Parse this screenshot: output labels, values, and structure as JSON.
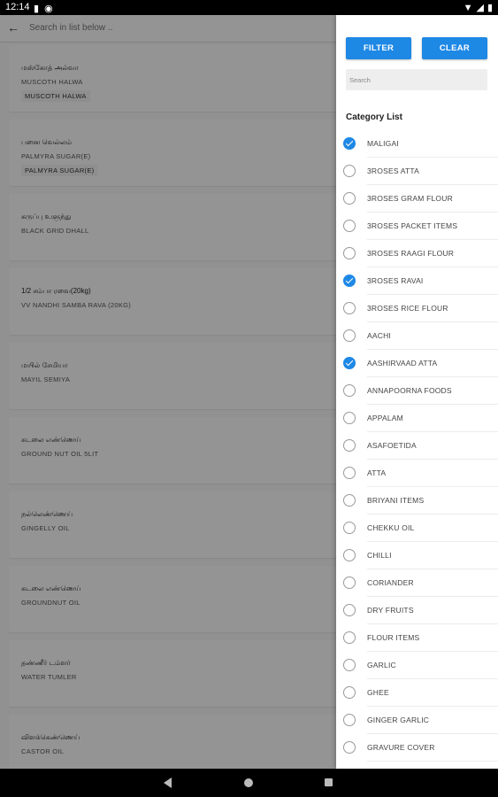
{
  "status_bar": {
    "time": "12:14"
  },
  "search_bar": {
    "placeholder": "Search in list below .."
  },
  "products": [
    {
      "tamil": "மஸ்கோத் அல்வா",
      "english": "MUSCOTH HALWA",
      "tag": "MUSCOTH HALWA"
    },
    {
      "tamil": "பனை வெல்லம்",
      "english": "PALMYRA SUGAR(E)",
      "tag": "PALMYRA SUGAR(E)"
    },
    {
      "tamil": "கருப்பு உளுந்து",
      "english": "BLACK GRID DHALL",
      "tag": ""
    },
    {
      "tamil": "1/2 சம்பா ரவை(20kg)",
      "english": "VV NANDHI SAMBA RAVA (20KG)",
      "tag": ""
    },
    {
      "tamil": "மயில் சேமியா",
      "english": "MAYIL SEMIYA",
      "tag": ""
    },
    {
      "tamil": "கடலை எண்ணெய்",
      "english": "GROUND NUT OIL 5LIT",
      "tag": ""
    },
    {
      "tamil": "நல்லெண்ணெய்",
      "english": "GINGELLY OIL",
      "tag": ""
    },
    {
      "tamil": "கடலை எண்ணெய்",
      "english": "GROUNDNUT OIL",
      "tag": ""
    },
    {
      "tamil": "தண்ணீர் டம்ளர்",
      "english": "WATER TUMLER",
      "tag": ""
    },
    {
      "tamil": "விளக்கெண்ணெய்",
      "english": "CASTOR OIL",
      "tag": ""
    }
  ],
  "drawer": {
    "filter_label": "FILTER",
    "clear_label": "CLEAR",
    "search_placeholder": "Search",
    "category_title": "Category List",
    "categories": [
      {
        "label": "MALIGAI",
        "checked": true
      },
      {
        "label": "3ROSES ATTA",
        "checked": false
      },
      {
        "label": "3ROSES GRAM FLOUR",
        "checked": false
      },
      {
        "label": "3ROSES PACKET ITEMS",
        "checked": false
      },
      {
        "label": "3ROSES RAAGI FLOUR",
        "checked": false
      },
      {
        "label": "3ROSES RAVAI",
        "checked": true
      },
      {
        "label": "3ROSES RICE FLOUR",
        "checked": false
      },
      {
        "label": "AACHI",
        "checked": false
      },
      {
        "label": "AASHIRVAAD ATTA",
        "checked": true
      },
      {
        "label": "ANNAPOORNA FOODS",
        "checked": false
      },
      {
        "label": "APPALAM",
        "checked": false
      },
      {
        "label": "ASAFOETIDA",
        "checked": false
      },
      {
        "label": "ATTA",
        "checked": false
      },
      {
        "label": "BRIYANI ITEMS",
        "checked": false
      },
      {
        "label": "CHEKKU OIL",
        "checked": false
      },
      {
        "label": "CHILLI",
        "checked": false
      },
      {
        "label": "CORIANDER",
        "checked": false
      },
      {
        "label": "DRY FRUITS",
        "checked": false
      },
      {
        "label": "FLOUR ITEMS",
        "checked": false
      },
      {
        "label": "GARLIC",
        "checked": false
      },
      {
        "label": "GHEE",
        "checked": false
      },
      {
        "label": "GINGER GARLIC",
        "checked": false
      },
      {
        "label": "GRAVURE COVER",
        "checked": false
      }
    ]
  },
  "colors": {
    "accent": "#1e88e5",
    "scrim": "rgba(0,0,0,0.42)"
  }
}
